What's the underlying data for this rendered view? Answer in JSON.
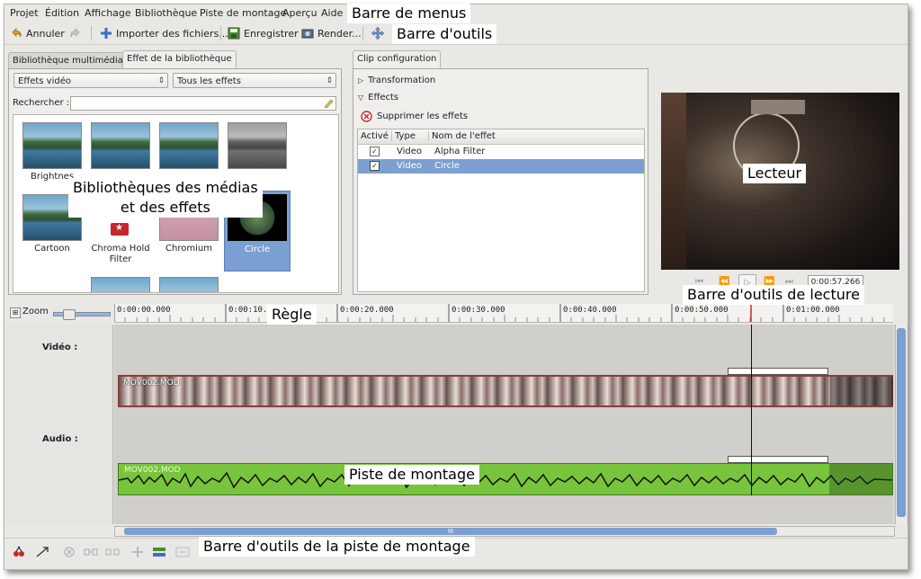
{
  "menu": [
    "Projet",
    "Édition",
    "Affichage",
    "Bibliothèque",
    "Piste de montage",
    "Aperçu",
    "Aide"
  ],
  "toolbar": {
    "undo": "Annuler",
    "import": "Importer des fichiers...",
    "save": "Enregistrer",
    "render": "Render..."
  },
  "library": {
    "tabs": [
      "Bibliothèque multimédia",
      "Effet de la bibliothèque"
    ],
    "filter_type": "Effets vidéo",
    "filter_all": "Tous les effets",
    "search_label": "Rechercher :",
    "effects": [
      "Brightnes",
      "Cartoon",
      "Chroma Hold Filter",
      "Chromium",
      "Circle"
    ],
    "selected": "Circle"
  },
  "clip_config": {
    "tab": "Clip configuration",
    "transformation": "Transformation",
    "effects": "Effects",
    "remove_button": "Supprimer les effets",
    "columns": [
      "Activé",
      "Type",
      "Nom de l'effet"
    ],
    "rows": [
      {
        "type": "Video",
        "name": "Alpha Filter",
        "active": true
      },
      {
        "type": "Video",
        "name": "Circle",
        "active": true,
        "selected": true
      }
    ]
  },
  "player": {
    "timecode": "0:00:57.266"
  },
  "timeline": {
    "zoom_label": "Zoom",
    "ruler_ticks": [
      "0:00:00.000",
      "0:00:10.000",
      "0:00:20.000",
      "0:00:30.000",
      "0:00:40.000",
      "0:00:50.000",
      "0:01:00.000"
    ],
    "tracks": [
      {
        "label": "Vidéo :",
        "clip": "MOV002.MOD"
      },
      {
        "label": "Audio :",
        "clip": "MOV002.MOD"
      }
    ],
    "scroll_label": "III"
  },
  "annotations": {
    "menubar": "Barre de menus",
    "toolbar": "Barre d'outils",
    "libraries": "Bibliothèques des médias\net des effets",
    "player": "Lecteur",
    "player_toolbar": "Barre d'outils de lecture",
    "ruler": "Règle",
    "timeline": "Piste de montage",
    "timeline_toolbar": "Barre d'outils de la piste de montage"
  },
  "colors": {
    "selection": "#7b9fd0",
    "audio_clip": "#78c43c",
    "video_clip_border": "#8e3b3b",
    "playhead": "#d22222"
  }
}
